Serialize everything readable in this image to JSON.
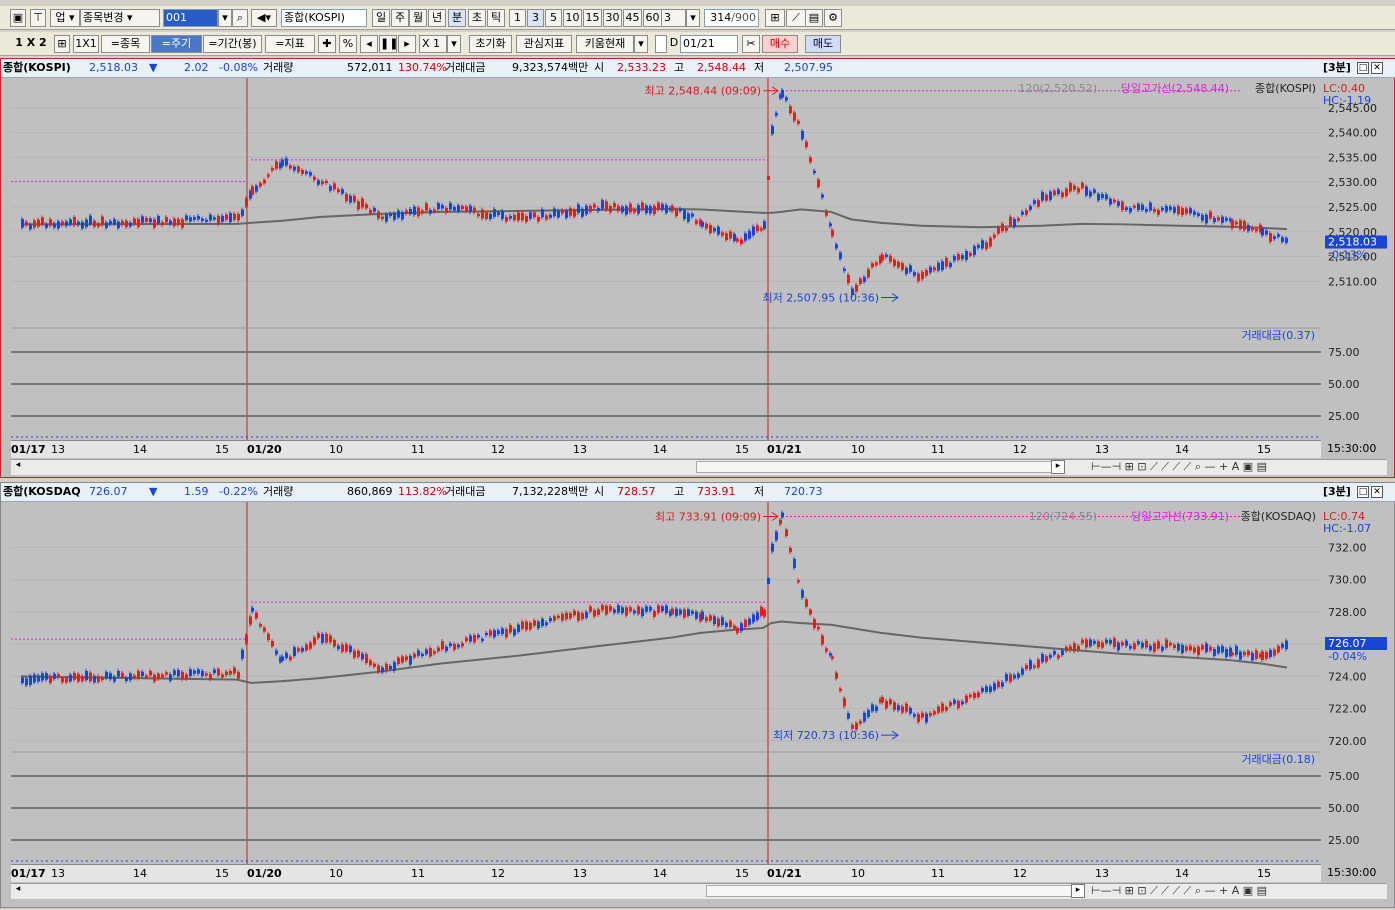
{
  "toolbar1": {
    "b1": "업",
    "market": "종목변경",
    "code": "001",
    "name": "종합(KOSPI)",
    "periods": [
      "일",
      "주",
      "월",
      "년",
      "분",
      "초",
      "틱"
    ],
    "active_period": "분",
    "mins": [
      "1",
      "3",
      "5",
      "10",
      "15",
      "30",
      "45",
      "60"
    ],
    "active_min": "3",
    "count": "3",
    "bars": "314",
    "barsmax": "/900"
  },
  "toolbar2": {
    "layout": "1 X 2",
    "b1x1": "1X1",
    "symbol": "=종목",
    "cycle": "=주기",
    "range": "=기간(봉)",
    "indicator": "=지표",
    "zoom": "X 1",
    "reset": "초기화",
    "favind": "관심지표",
    "kiwoom": "키움현재",
    "date": "01/21",
    "buy": "매수",
    "sell": "매도",
    "d": "D"
  },
  "colors": {
    "up": "#e02020",
    "down": "#1a44d4",
    "ma": "#666666",
    "dash": "#e020e0",
    "grid": "#b5b5b5",
    "bg": "#c0c0c0"
  },
  "panels": [
    {
      "id": "kospi",
      "name": "종합(KOSPI)",
      "price": "2,518.03",
      "arrow": "▼",
      "change": "2.02",
      "pct": "-0.08%",
      "vol_label": "거래량",
      "vol": "572,011",
      "vol_pct": "130.74%",
      "amt_label": "거래대금",
      "amt": "9,323,574백만",
      "open_label": "시",
      "open": "2,533.23",
      "high_label": "고",
      "high": "2,548.44",
      "low_label": "저",
      "low": "2,507.95",
      "tag": "[3분]",
      "ma_label": "120(2,520.52)",
      "hline_label": "당일고가선(2,548.44)",
      "legend_name": "종합(KOSPI)",
      "lc": "LC:0.40",
      "hc": "HC:-1.19",
      "hi_ann": "최고 2,548.44 (09:09)",
      "lo_ann": "최저 2,507.95 (10:36)",
      "cur_price": "2,518.03",
      "cur_pct": "-0.13%",
      "sub_label": "거래대금(0.37)",
      "sub_ticks": [
        "75.00",
        "50.00",
        "25.00"
      ]
    },
    {
      "id": "kosdaq",
      "name": "종합(KOSDAQ",
      "price": "726.07",
      "arrow": "▼",
      "change": "1.59",
      "pct": "-0.22%",
      "vol_label": "거래량",
      "vol": "860,869",
      "vol_pct": "113.82%",
      "amt_label": "거래대금",
      "amt": "7,132,228백만",
      "open_label": "시",
      "open": "728.57",
      "high_label": "고",
      "high": "733.91",
      "low_label": "저",
      "low": "720.73",
      "tag": "[3분]",
      "ma_label": "120(724.55)",
      "hline_label": "당일고가선(733.91)",
      "legend_name": "종합(KOSDAQ)",
      "lc": "LC:0.74",
      "hc": "HC:-1.07",
      "hi_ann": "최고 733.91 (09:09)",
      "lo_ann": "최저 720.73 (10:36)",
      "cur_price": "726.07",
      "cur_pct": "-0.04%",
      "sub_label": "거래대금(0.18)",
      "sub_ticks": [
        "75.00",
        "50.00",
        "25.00"
      ]
    }
  ],
  "x_axis": {
    "labels": [
      "01/17",
      "13",
      "14",
      "15",
      "01/20",
      "10",
      "11",
      "12",
      "13",
      "14",
      "15",
      "01/21",
      "10",
      "11",
      "12",
      "13",
      "14",
      "15"
    ],
    "end": "15:30:00"
  },
  "chart_data": [
    {
      "type": "line",
      "title": "종합(KOSPI) 3분",
      "x": [
        "01/17 12:00",
        "01/17 15:30",
        "01/20 09:00",
        "01/20 09:30",
        "01/20 10:00",
        "01/20 10:30",
        "01/20 11:00",
        "01/20 12:00",
        "01/20 13:00",
        "01/20 14:00",
        "01/20 14:30",
        "01/20 15:00",
        "01/20 15:20",
        "01/21 09:00",
        "01/21 09:09",
        "01/21 09:30",
        "01/21 10:00",
        "01/21 10:36",
        "01/21 11:00",
        "01/21 11:30",
        "01/21 12:00",
        "01/21 12:30",
        "01/21 13:00",
        "01/21 13:30",
        "01/21 14:00",
        "01/21 14:30",
        "01/21 15:00",
        "01/21 15:20"
      ],
      "series": [
        {
          "name": "종합(KOSPI)",
          "values": [
            2521.5,
            2522.5,
            2528.5,
            2534.0,
            2530.0,
            2523.0,
            2525.0,
            2522.5,
            2525.0,
            2524.5,
            2522.0,
            2518.0,
            2521.0,
            2540.0,
            2548.44,
            2540.0,
            2520.0,
            2507.95,
            2515.0,
            2511.0,
            2517.0,
            2527.0,
            2529.0,
            2525.0,
            2524.0,
            2522.0,
            2520.0,
            2518.03
          ]
        },
        {
          "name": "120",
          "values": [
            2521.5,
            2521.6,
            2521.8,
            2522.2,
            2523.0,
            2523.6,
            2524.0,
            2524.2,
            2524.4,
            2524.6,
            2524.5,
            2524.1,
            2523.8,
            2523.8,
            2524.0,
            2524.5,
            2524.0,
            2522.5,
            2521.8,
            2521.2,
            2520.9,
            2521.2,
            2521.6,
            2521.5,
            2521.2,
            2521.0,
            2520.8,
            2520.52
          ]
        }
      ],
      "ylim": [
        2502,
        2550
      ],
      "yticks": [
        2510,
        2515,
        2520,
        2525,
        2530,
        2535,
        2540,
        2545
      ],
      "grid": true
    },
    {
      "type": "line",
      "title": "종합(KOSDAQ) 3분",
      "x": [
        "01/17 12:00",
        "01/17 15:30",
        "01/20 09:00",
        "01/20 09:30",
        "01/20 10:00",
        "01/20 10:30",
        "01/20 11:00",
        "01/20 12:00",
        "01/20 13:00",
        "01/20 14:00",
        "01/20 14:30",
        "01/20 15:00",
        "01/20 15:20",
        "01/21 09:00",
        "01/21 09:09",
        "01/21 09:30",
        "01/21 10:00",
        "01/21 10:36",
        "01/21 11:00",
        "01/21 11:30",
        "01/21 12:00",
        "01/21 12:30",
        "01/21 13:00",
        "01/21 13:30",
        "01/21 14:00",
        "01/21 14:30",
        "01/21 15:00",
        "01/21 15:20"
      ],
      "series": [
        {
          "name": "종합(KOSDAQ)",
          "values": [
            723.8,
            724.2,
            728.0,
            725.0,
            726.5,
            724.5,
            725.8,
            727.0,
            728.2,
            728.0,
            727.8,
            727.0,
            728.0,
            732.0,
            733.91,
            729.0,
            725.0,
            720.73,
            722.5,
            721.5,
            723.0,
            725.0,
            726.0,
            726.0,
            725.8,
            725.5,
            725.2,
            726.07
          ]
        },
        {
          "name": "120",
          "values": [
            724.0,
            723.8,
            723.6,
            723.7,
            723.9,
            724.3,
            724.8,
            725.3,
            725.9,
            726.4,
            726.7,
            726.9,
            727.0,
            727.3,
            727.4,
            727.3,
            727.2,
            727.0,
            726.7,
            726.4,
            726.1,
            725.8,
            725.6,
            725.4,
            725.2,
            725.0,
            724.8,
            724.55
          ]
        }
      ],
      "ylim": [
        719.5,
        734.5
      ],
      "yticks": [
        720,
        722,
        724,
        726,
        728,
        730,
        732
      ],
      "grid": true
    }
  ]
}
